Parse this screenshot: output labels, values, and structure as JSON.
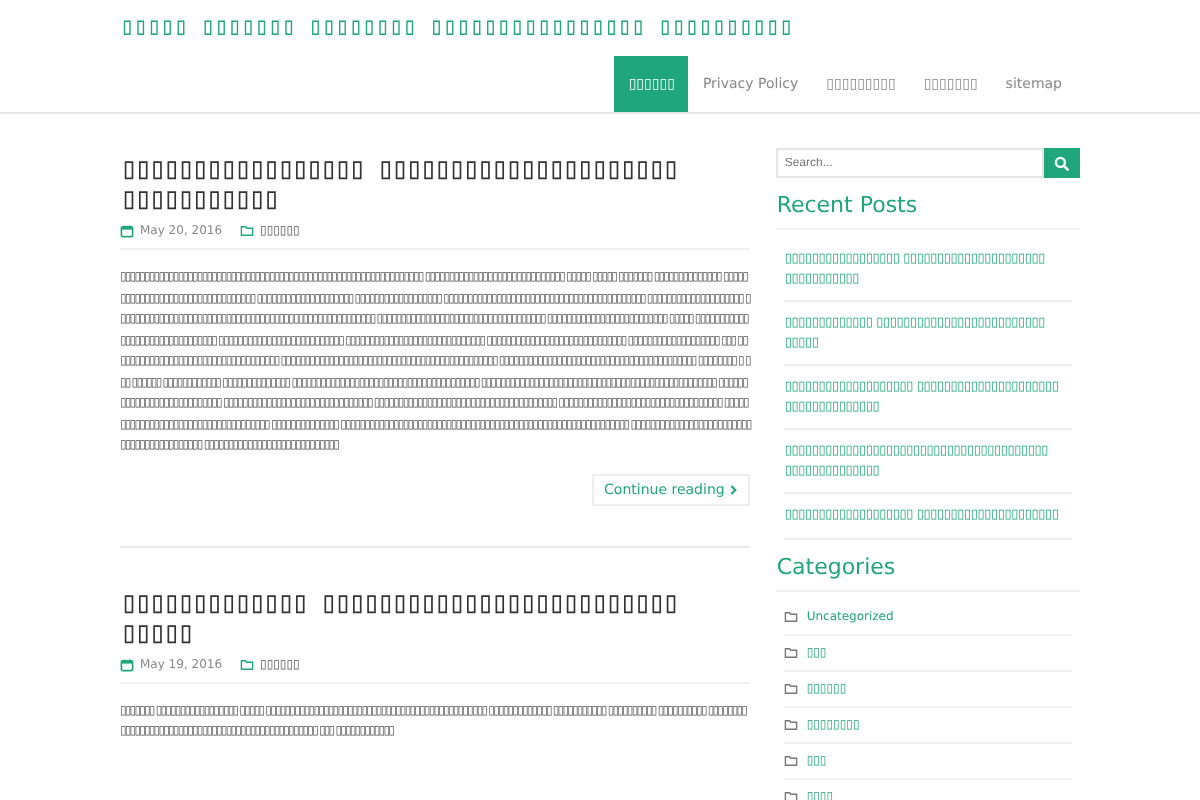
{
  "site_title": "▯▯▯▯▯ ▯▯▯▯▯▯▯ ▯▯▯▯▯▯▯▯ ▯▯▯▯▯▯▯▯▯▯▯▯▯▯▯▯ ▯▯▯▯▯▯▯▯▯▯",
  "nav": [
    {
      "label": "▯▯▯▯▯▯",
      "selected": true
    },
    {
      "label": "Privacy Policy",
      "selected": false
    },
    {
      "label": "▯▯▯▯▯▯▯▯▯",
      "selected": false
    },
    {
      "label": "▯▯▯▯▯▯▯",
      "selected": false
    },
    {
      "label": "sitemap",
      "selected": false
    }
  ],
  "posts": [
    {
      "title": "▯▯▯▯▯▯▯▯▯▯▯▯▯▯▯▯▯ ▯▯▯▯▯▯▯▯▯▯▯▯▯▯▯▯▯▯▯▯▯ ▯▯▯▯▯▯▯▯▯▯▯",
      "date": "May 20, 2016",
      "category": "▯▯▯▯▯▯",
      "excerpt": "▯▯▯▯▯▯▯▯▯▯▯▯▯▯▯▯▯▯▯▯▯▯▯▯▯▯▯▯▯▯▯▯▯▯▯▯▯▯▯▯▯▯▯▯▯▯▯▯▯▯▯▯▯▯▯▯▯▯▯▯▯▯▯ ▯▯▯▯▯▯▯▯▯▯▯▯▯▯▯▯▯▯▯▯▯▯▯▯▯▯▯▯▯ ▯▯▯▯▯ ▯▯▯▯▯ ▯▯▯▯▯▯▯ ▯▯▯▯▯▯▯▯▯▯▯▯▯▯ ▯▯▯▯▯ ▯▯▯▯▯▯▯▯▯▯▯▯▯▯▯▯▯▯▯▯▯▯▯▯▯▯▯▯ ▯▯▯▯▯▯▯▯▯▯▯▯▯▯▯▯▯▯▯▯ ▯▯▯▯▯▯▯▯▯▯▯▯▯▯▯▯▯▯ ▯▯▯▯▯▯▯▯▯▯▯▯▯▯▯▯▯▯▯▯▯▯▯▯▯▯▯▯▯▯▯▯▯▯▯▯▯▯▯▯▯▯ ▯▯▯▯▯▯▯▯▯▯▯▯▯▯▯▯▯▯▯▯ ▯▯▯▯▯▯▯▯▯▯▯▯▯▯▯▯▯▯▯▯▯▯▯▯▯▯▯▯▯▯▯▯▯▯▯▯▯▯▯▯▯▯▯▯▯▯▯▯▯▯▯▯▯▯ ▯▯▯▯▯▯▯▯▯▯▯▯▯▯▯▯▯▯▯▯▯▯▯▯▯▯▯▯▯▯▯▯▯▯▯ ▯▯▯▯▯▯▯▯▯▯▯▯▯▯▯▯▯▯▯▯▯▯▯▯▯ ▯▯▯▯▯ ▯▯▯▯▯▯▯▯▯▯▯▯▯▯▯▯▯▯▯▯▯▯▯▯▯▯▯▯▯▯▯ ▯▯▯▯▯▯▯▯▯▯▯▯▯▯▯▯▯▯▯▯▯▯▯▯▯▯ ▯▯▯▯▯▯▯▯▯▯▯▯▯▯▯▯▯▯▯▯▯▯▯▯▯▯▯▯▯ ▯▯▯▯▯▯▯▯▯▯▯▯▯▯▯▯▯▯▯▯▯▯▯▯▯▯▯▯▯ ▯▯▯▯▯▯▯▯▯▯▯▯▯▯▯▯▯▯▯ ▯▯▯ ▯▯▯▯▯▯▯▯▯▯▯▯▯▯▯▯▯▯▯▯▯▯▯▯▯▯▯▯▯▯▯▯▯▯▯ ▯▯▯▯▯▯▯▯▯▯▯▯▯▯▯▯▯▯▯▯▯▯▯▯▯▯▯▯▯▯▯▯▯▯▯▯▯▯▯▯▯▯▯▯▯ ▯▯▯▯▯▯▯▯▯▯▯▯▯▯▯▯▯▯▯▯▯▯▯▯▯▯▯▯▯▯▯▯▯▯▯▯▯▯▯▯▯ ▯▯▯▯▯▯▯▯ ▯ ▯▯▯ ▯▯▯▯▯▯ ▯▯▯▯▯▯▯▯▯▯▯▯ ▯▯▯▯▯▯▯▯▯▯▯▯▯▯ ▯▯▯▯▯▯▯▯▯▯▯▯▯▯▯▯▯▯▯▯▯▯▯▯▯▯▯▯▯▯▯▯▯▯▯▯▯▯▯ ▯▯▯▯▯▯▯▯▯▯▯▯▯▯▯▯▯▯▯▯▯▯▯▯▯▯▯▯▯▯▯▯▯▯▯▯▯▯▯▯▯▯▯▯▯▯▯▯▯ ▯▯▯▯▯▯▯▯▯▯▯▯▯▯▯▯▯▯▯▯▯▯▯▯▯▯▯ ▯▯▯▯▯▯▯▯▯▯▯▯▯▯▯▯▯▯▯▯▯▯▯▯▯▯▯▯▯▯▯ ▯▯▯▯▯▯▯▯▯▯▯▯▯▯▯▯▯▯▯▯▯▯▯▯▯▯▯▯▯▯▯▯▯▯▯▯▯▯ ▯▯▯▯▯▯▯▯▯▯▯▯▯▯▯▯▯▯▯▯▯▯▯▯▯▯▯▯▯▯▯▯▯▯ ▯▯▯▯▯▯▯▯▯▯▯▯▯▯▯▯▯▯▯▯▯▯▯▯▯▯▯▯▯▯▯▯▯▯▯▯ ▯▯▯▯▯▯▯▯▯▯▯▯▯▯ ▯▯▯▯▯▯▯▯▯▯▯▯▯▯▯▯▯▯▯▯▯▯▯▯▯▯▯▯▯▯▯▯▯▯▯▯▯▯▯▯▯▯▯▯▯▯▯▯▯▯▯▯▯▯▯▯▯▯▯▯ ▯▯▯▯▯▯▯▯▯▯▯▯▯▯▯▯▯▯▯▯▯▯▯▯▯▯▯▯▯▯▯▯▯▯▯▯▯▯▯▯▯▯ ▯▯▯▯▯▯▯▯▯▯▯▯▯▯▯▯▯▯▯▯▯▯▯▯▯▯▯▯",
      "link": "Continue reading"
    },
    {
      "title": "▯▯▯▯▯▯▯▯▯▯▯▯▯ ▯▯▯▯▯▯▯▯▯▯▯▯▯▯▯▯▯▯▯▯▯▯▯▯▯ ▯▯▯▯▯",
      "date": "May 19, 2016",
      "category": "▯▯▯▯▯▯",
      "excerpt": "▯▯▯▯▯▯▯ ▯▯▯▯▯▯▯▯▯▯▯▯▯▯▯▯▯ ▯▯▯▯▯ ▯▯▯▯▯▯▯▯▯▯▯▯▯▯▯▯▯▯▯▯▯▯▯▯▯▯▯▯▯▯▯▯▯▯▯▯▯▯▯▯▯▯▯▯▯▯ ▯▯▯▯▯▯▯▯▯▯▯▯▯ ▯▯▯▯▯▯▯▯▯▯▯ ▯▯▯▯▯▯▯▯▯▯ ▯▯▯▯▯▯▯▯▯▯ ▯▯▯▯▯▯▯▯▯▯▯▯▯▯▯▯▯▯▯▯▯▯▯▯▯▯▯▯▯▯▯▯▯▯▯▯▯▯▯▯▯▯▯▯▯▯▯▯▯ ▯▯▯ ▯▯▯▯▯▯▯▯▯▯▯▯"
    }
  ],
  "search": {
    "placeholder": "Search..."
  },
  "recent_posts": {
    "title": "Recent Posts",
    "items": [
      "▯▯▯▯▯▯▯▯▯▯▯▯▯▯▯▯▯ ▯▯▯▯▯▯▯▯▯▯▯▯▯▯▯▯▯▯▯▯▯ ▯▯▯▯▯▯▯▯▯▯▯",
      "▯▯▯▯▯▯▯▯▯▯▯▯▯ ▯▯▯▯▯▯▯▯▯▯▯▯▯▯▯▯▯▯▯▯▯▯▯▯▯ ▯▯▯▯▯",
      "▯▯▯▯▯▯▯▯▯▯▯▯▯▯▯▯▯▯▯ ▯▯▯▯▯▯▯▯▯▯▯▯▯▯▯▯▯▯▯▯▯ ▯▯▯▯▯▯▯▯▯▯▯▯▯▯",
      "▯▯▯▯▯▯▯▯▯▯▯▯▯▯▯▯▯▯▯▯▯▯▯▯▯▯▯▯▯▯▯▯▯▯▯▯▯▯▯ ▯▯▯▯▯▯▯▯▯▯▯▯▯▯",
      "▯▯▯▯▯▯▯▯▯▯▯▯▯▯▯▯▯▯▯ ▯▯▯▯▯▯▯▯▯▯▯▯▯▯▯▯▯▯▯▯▯"
    ]
  },
  "categories": {
    "title": "Categories",
    "items": [
      "Uncategorized",
      "▯▯▯",
      "▯▯▯▯▯▯",
      "▯▯▯▯▯▯▯▯",
      "▯▯▯",
      "▯▯▯▯"
    ]
  }
}
